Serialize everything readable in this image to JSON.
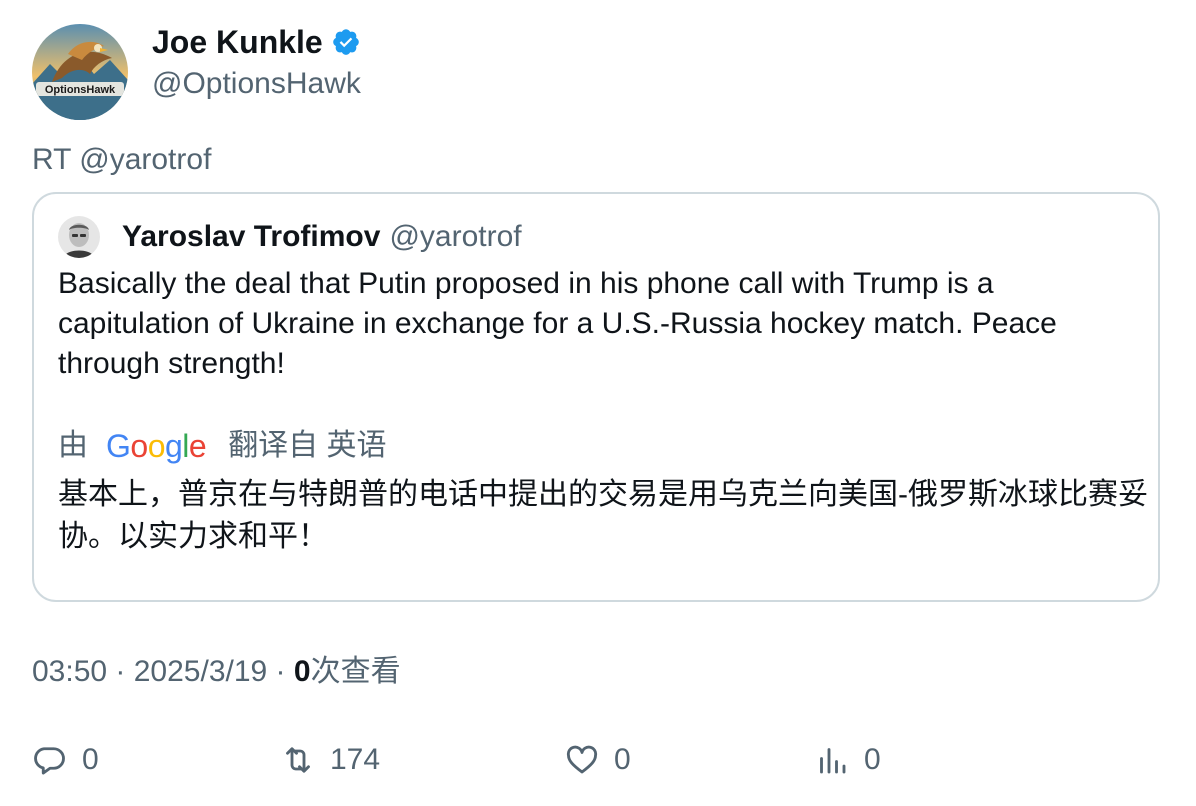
{
  "author": {
    "display_name": "Joe Kunkle",
    "handle": "@OptionsHawk",
    "avatar_text": "OptionsHawk",
    "verified": true
  },
  "retweet_line": "RT @yarotrof",
  "quoted": {
    "display_name": "Yaroslav Trofimov",
    "handle": "@yarotrof",
    "text": "Basically the deal that Putin proposed in his phone call with Trump is a capitulation of Ukraine in exchange for a U.S.-Russia hockey match. Peace through strength!",
    "translation": {
      "by_prefix": "由",
      "provider": "Google",
      "suffix": "翻译自 英语",
      "text": "基本上，普京在与特朗普的电话中提出的交易是用乌克兰向美国-俄罗斯冰球比赛妥协。以实力求和平！"
    }
  },
  "meta": {
    "time": "03:50",
    "sep1": " · ",
    "date": "2025/3/19",
    "sep2": " · ",
    "views_count": "0",
    "views_label": "次查看"
  },
  "actions": {
    "reply_count": "0",
    "retweet_count": "174",
    "like_count": "0",
    "views_count": "0"
  },
  "colors": {
    "verified": "#1d9bf0",
    "secondary_text": "#536471",
    "primary_text": "#0f1419",
    "border": "#cfd9de"
  }
}
